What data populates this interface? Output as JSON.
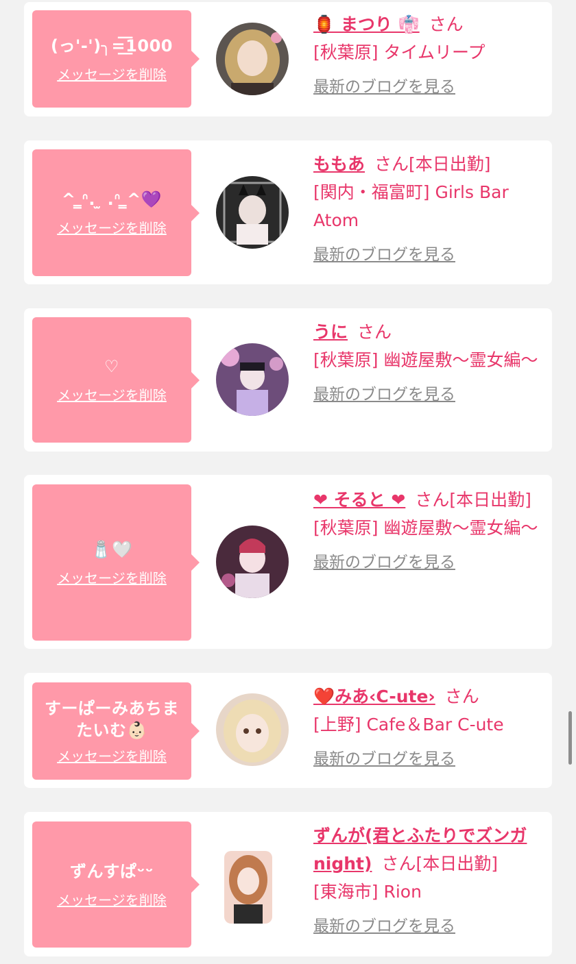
{
  "delete_label": "メッセージを削除",
  "blog_label": "最新のブログを見る",
  "san_label": "さん",
  "entries": [
    {
      "message": "(っ'-')╮=͟͟͞͞1000",
      "name": "🏮 まつり 👘",
      "status": "",
      "shop": "[秋葉原] タイムリープ"
    },
    {
      "message": "^ ̳ᐢ. ̫ .ᐢ ̳^💜",
      "name": "ももあ",
      "status": "[本日出勤]",
      "shop": "[関内・福富町] Girls Bar Atom"
    },
    {
      "message": "♡",
      "name": "うに",
      "status": "",
      "shop": "[秋葉原] 幽遊屋敷〜霊女編〜"
    },
    {
      "message": "🧂🤍",
      "name": "❤ そると ❤",
      "status": "[本日出勤]",
      "shop": "[秋葉原] 幽遊屋敷〜霊女編〜"
    },
    {
      "message": "すーぱーみあちまたいむ👶🏻",
      "name": "❤️みあ‹C-ute›",
      "status": "",
      "shop": "[上野] Cafe＆Bar C-ute"
    },
    {
      "message": "ずんすぱᵕᵕ",
      "name": "ずんが(君とふたりでズンガnight)",
      "status": "[本日出勤]",
      "shop": "[東海市] Rion"
    }
  ],
  "colors": {
    "accent": "#e8366a",
    "bubble": "#ff99a9",
    "link_gray": "#8a8a8a",
    "background": "#f2f2f2"
  }
}
